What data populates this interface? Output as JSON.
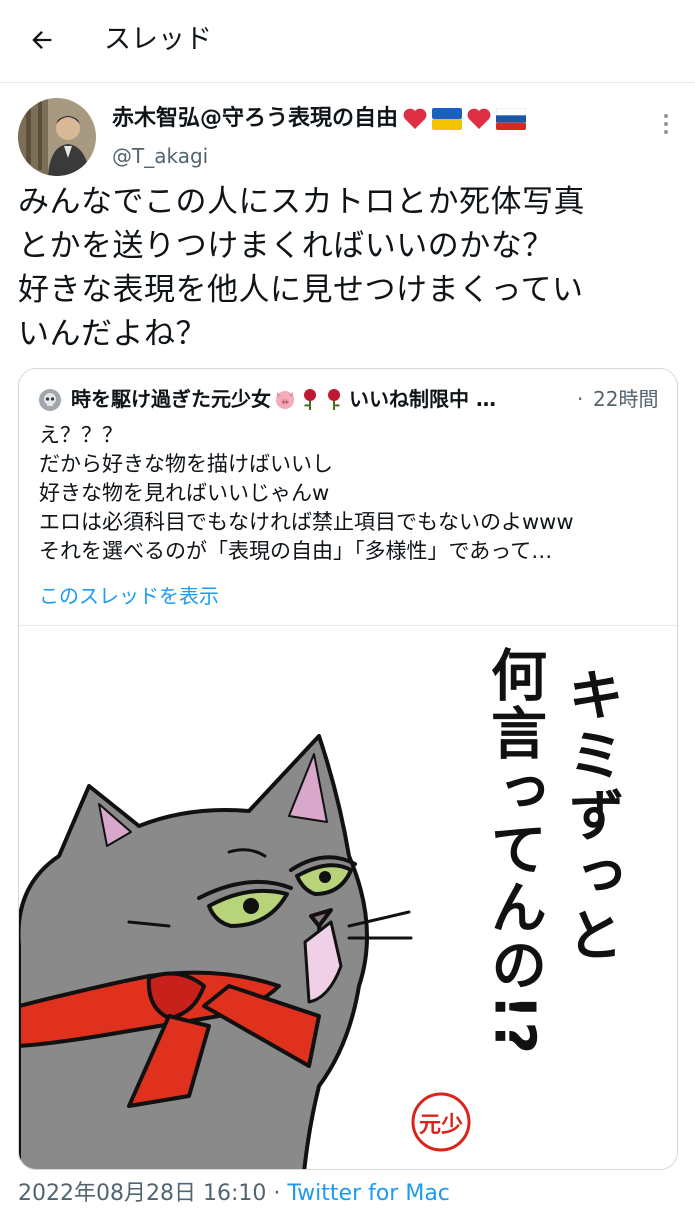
{
  "header": {
    "title": "スレッド"
  },
  "tweet": {
    "display_name": "赤木智弘@守ろう表現の自由",
    "handle": "@T_akagi",
    "text_lines": [
      "みんなでこの人にスカトロとか死体写真",
      "とかを送りつけまくればいいのかな？",
      "好きな表現を他人に見せつけまくってい",
      "いんだよね？"
    ],
    "timestamp": "2022年08月28日 16:10",
    "separator": "·",
    "source": "Twitter for Mac"
  },
  "quote": {
    "display_name": "時を駆け過ぎた元少女",
    "suffix": "いいね制限中 …",
    "separator": "·",
    "time": "22時間",
    "text_lines": [
      "え？？？",
      "だから好きな物を描けばいいし",
      "好きな物を見ればいいじゃんw",
      "エロは必須科目でもなければ禁止項目でもないのよwww",
      "それを選べるのが「表現の自由」「多様性」であって…"
    ],
    "thread_link": "このスレッドを表示",
    "image": {
      "caption_col1": "キミずっと",
      "caption_col2": "何言ってんの!?",
      "seal": "元少"
    }
  },
  "colors": {
    "link": "#1d9bf0",
    "secondary": "#536471",
    "cat_body": "#8a8a8a",
    "scarf": "#e0301e",
    "seal": "#d9241c"
  }
}
